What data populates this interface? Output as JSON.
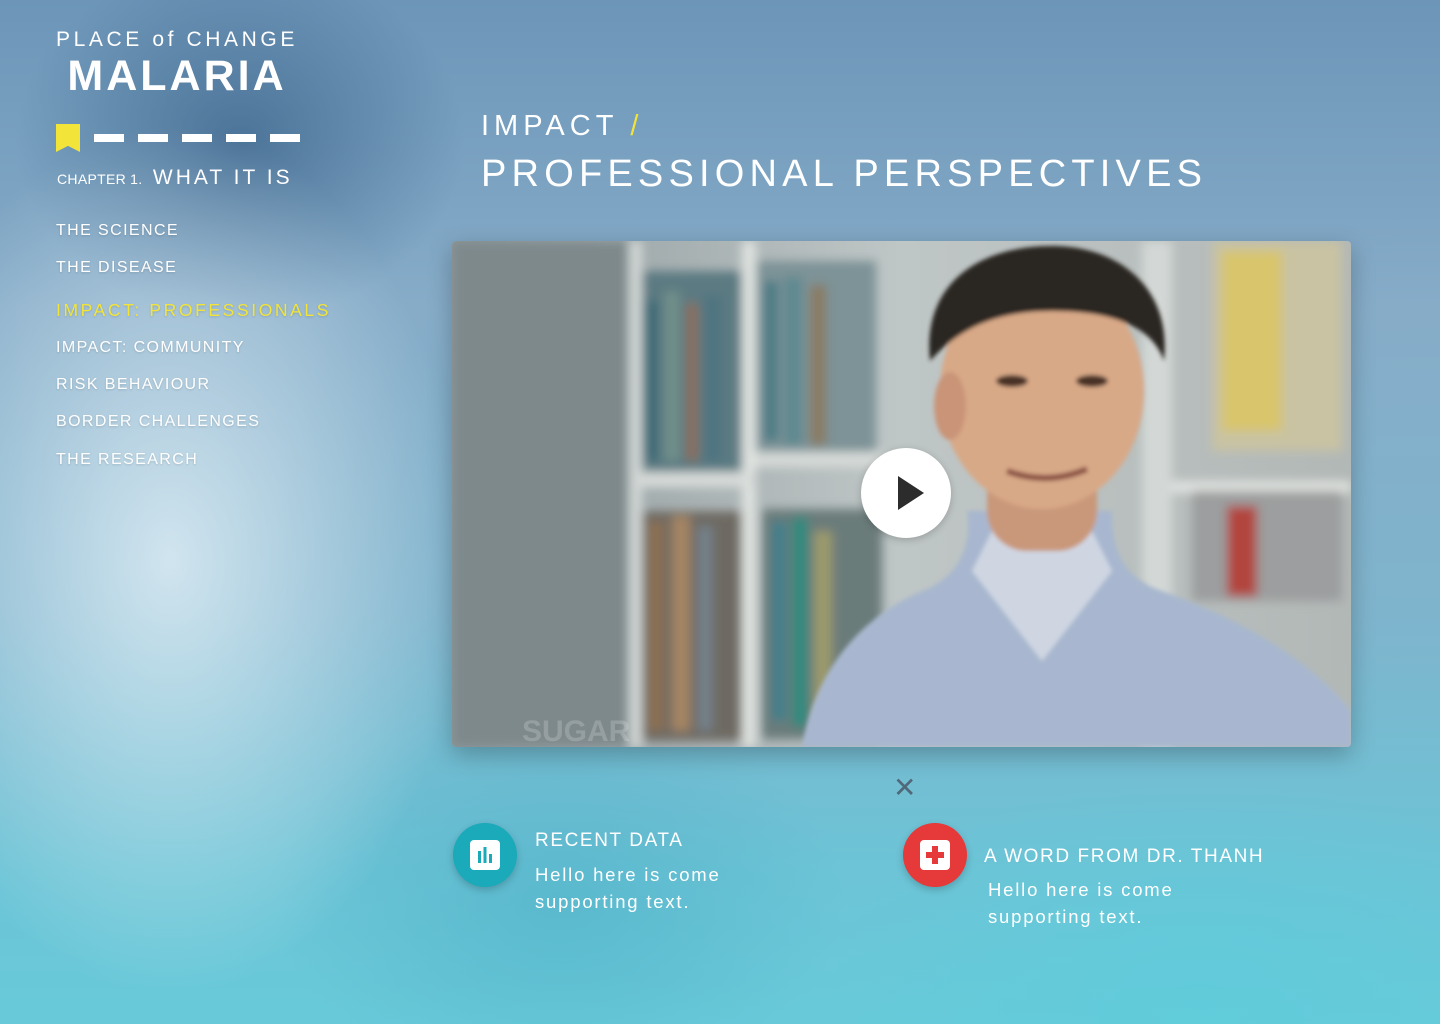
{
  "brand": {
    "top": "PLACE of CHANGE",
    "main": "MALARIA"
  },
  "chapter": {
    "number": "CHAPTER 1.",
    "title": "WHAT IT IS"
  },
  "nav": {
    "items": [
      {
        "label": "THE SCIENCE"
      },
      {
        "label": "THE DISEASE"
      },
      {
        "label": "IMPACT: PROFESSIONALS",
        "active": true
      },
      {
        "label": "IMPACT: COMMUNITY"
      },
      {
        "label": "RISK BEHAVIOUR"
      },
      {
        "label": "BORDER CHALLENGES"
      },
      {
        "label": "THE RESEARCH"
      }
    ]
  },
  "page": {
    "section": "IMPACT",
    "separator": "/",
    "title": "PROFESSIONAL PERSPECTIVES"
  },
  "video": {
    "watermark": "SUGAR",
    "play_icon": "play-icon",
    "close_icon": "close-icon"
  },
  "cards": {
    "data": {
      "title": "RECENT DATA",
      "text": "Hello here is come supporting text.",
      "icon": "bar-chart-icon",
      "color": "#1aaab9"
    },
    "quote": {
      "title": "A WORD FROM DR. THANH",
      "text": "Hello here is come supporting text.",
      "icon": "medical-cross-icon",
      "color": "#e5393a"
    }
  },
  "colors": {
    "accent": "#f2e438"
  }
}
